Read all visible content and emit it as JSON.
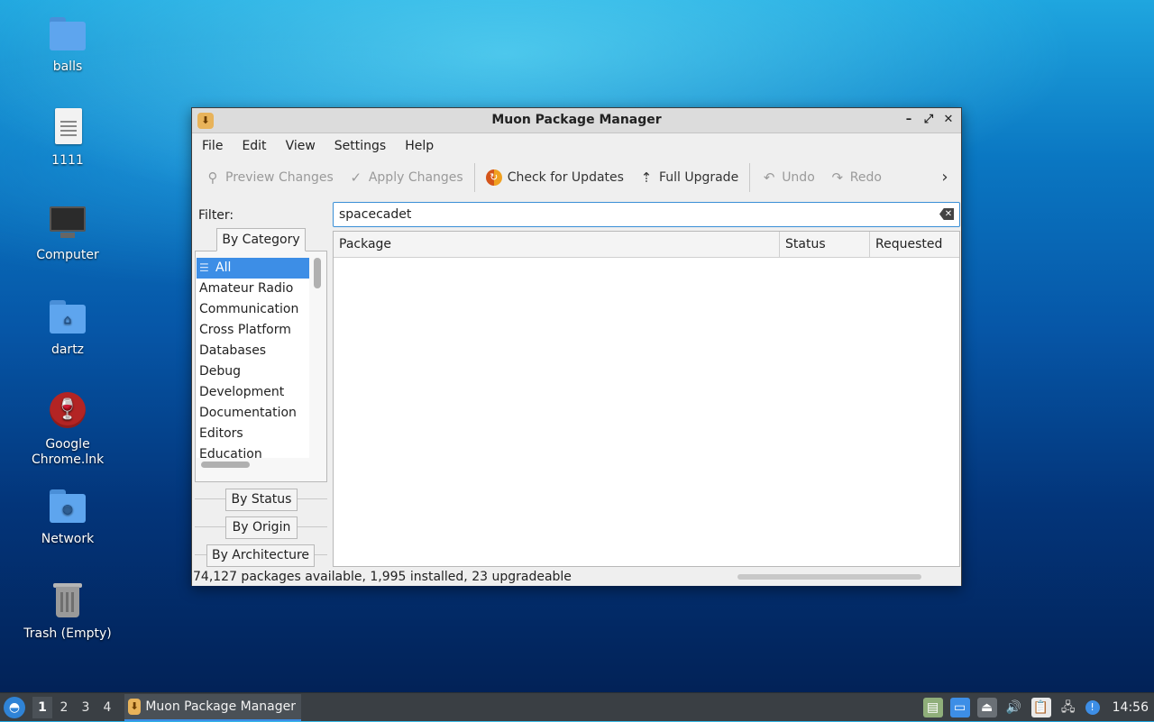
{
  "desktop": {
    "icons": [
      {
        "label": "balls",
        "icon": "folder-icon"
      },
      {
        "label": "1111",
        "icon": "text-file-icon"
      },
      {
        "label": "Computer",
        "icon": "computer-icon"
      },
      {
        "label": "dartz",
        "icon": "home-folder-icon"
      },
      {
        "label": "Google Chrome.lnk",
        "icon": "wine-glass-icon"
      },
      {
        "label": "Network",
        "icon": "network-folder-icon"
      },
      {
        "label": "Trash (Empty)",
        "icon": "trash-icon"
      }
    ]
  },
  "window": {
    "title": "Muon Package Manager",
    "menu": [
      "File",
      "Edit",
      "View",
      "Settings",
      "Help"
    ],
    "toolbar": {
      "preview_changes": "Preview Changes",
      "apply_changes": "Apply Changes",
      "check_updates": "Check for Updates",
      "full_upgrade": "Full Upgrade",
      "undo": "Undo",
      "redo": "Redo"
    },
    "filter": {
      "label": "Filter:",
      "search_value": "spacecadet"
    },
    "side_tabs": {
      "by_category": "By Category",
      "by_status": "By Status",
      "by_origin": "By Origin",
      "by_architecture": "By Architecture"
    },
    "categories": [
      "All",
      "Amateur Radio",
      "Communication",
      "Cross Platform",
      "Databases",
      "Debug",
      "Development",
      "Documentation",
      "Editors",
      "Education"
    ],
    "selected_category": "All",
    "table": {
      "columns": [
        "Package",
        "Status",
        "Requested"
      ],
      "rows": []
    },
    "status_text": "74,127 packages available, 1,995 installed, 23 upgradeable"
  },
  "taskbar": {
    "desktops": [
      "1",
      "2",
      "3",
      "4"
    ],
    "active_desktop": "1",
    "task_label": "Muon Package Manager",
    "clock": "14:56"
  },
  "colors": {
    "accent": "#3d8ee6",
    "taskbar": "#3a3f44",
    "window_bg": "#efefef"
  }
}
